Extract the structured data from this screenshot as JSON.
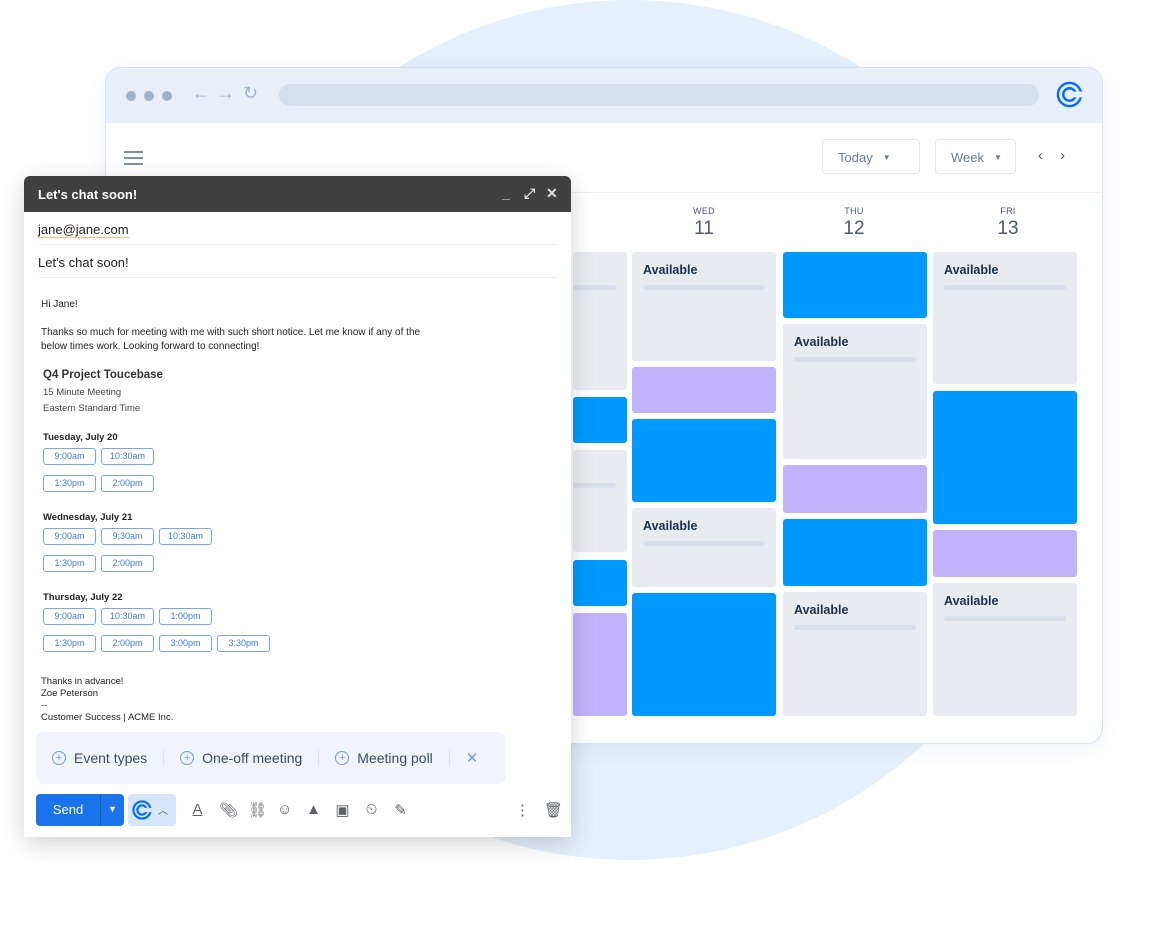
{
  "browser": {
    "logo": "calendly-logo-icon",
    "nav": [
      "back-arrow-icon",
      "forward-arrow-icon",
      "reload-icon"
    ]
  },
  "calendar": {
    "today_label": "Today",
    "view_label": "Week",
    "days": [
      {
        "name": "WED",
        "date": "11"
      },
      {
        "name": "THU",
        "date": "12"
      },
      {
        "name": "FRI",
        "date": "13"
      }
    ],
    "colors": {
      "busy": "#0099ff",
      "tentative": "#c0b3fb",
      "available": "#e8ecf1"
    },
    "available_label": "Available"
  },
  "email": {
    "window_title": "Let's chat soon!",
    "to": "jane@jane.com",
    "subject": "Let's chat soon!",
    "greeting": "Hi Jane!",
    "message": "Thanks so much for meeting with me with such short notice. Let me know if any of the below times work. Looking forward to connecting!",
    "event": {
      "title": "Q4 Project Toucebase",
      "duration": "15 Minute Meeting",
      "timezone": "Eastern Standard Time"
    },
    "days": [
      {
        "label": "Tuesday, July 20",
        "slots": [
          "9:00am",
          "10:30am",
          "1:30pm",
          "2:00pm"
        ]
      },
      {
        "label": "Wednesday, July 21",
        "slots": [
          "9:00am",
          "9:30am",
          "10:30am",
          "1:30pm",
          "2:00pm"
        ]
      },
      {
        "label": "Thursday, July 22",
        "slots": [
          "9:00am",
          "10:30am",
          "1:00pm",
          "1:30pm",
          "2:00pm",
          "3:00pm",
          "3:30pm"
        ]
      }
    ],
    "signoff": "Thanks in advance!",
    "name": "Zoe Peterson",
    "dash": "--",
    "org": "Customer Success | ACME Inc.",
    "calendly_bar": {
      "items": [
        "Event types",
        "One-off meeting",
        "Meeting poll"
      ]
    },
    "send_label": "Send"
  }
}
